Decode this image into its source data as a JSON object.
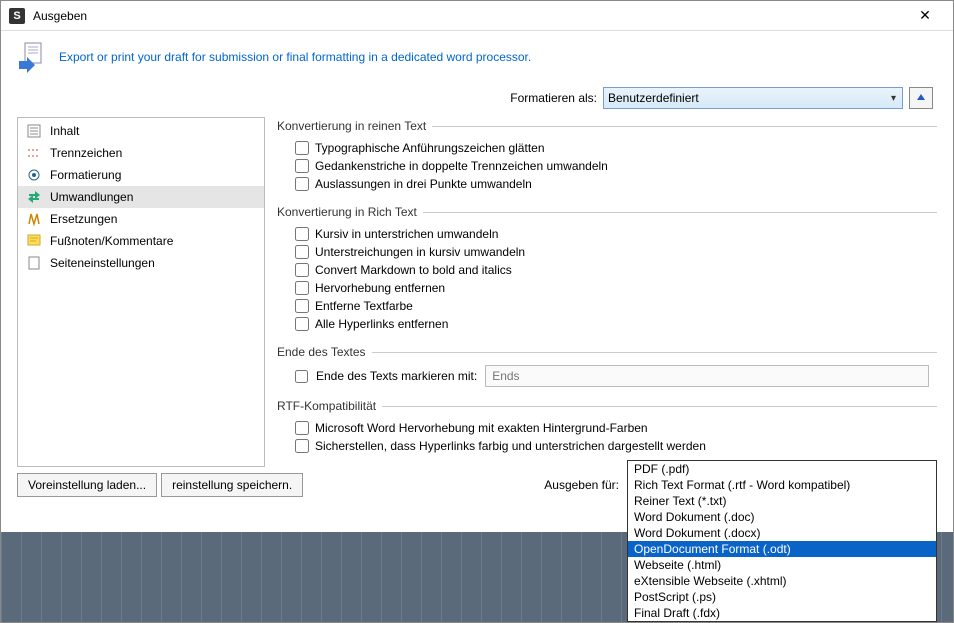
{
  "window": {
    "title": "Ausgeben"
  },
  "header": {
    "description": "Export or print your draft for submission or final formatting in a dedicated word processor."
  },
  "format": {
    "label": "Formatieren als:",
    "value": "Benutzerdefiniert"
  },
  "sidebar": {
    "items": [
      {
        "label": "Inhalt",
        "icon": "content"
      },
      {
        "label": "Trennzeichen",
        "icon": "separator"
      },
      {
        "label": "Formatierung",
        "icon": "format"
      },
      {
        "label": "Umwandlungen",
        "icon": "transform",
        "selected": true
      },
      {
        "label": "Ersetzungen",
        "icon": "replace"
      },
      {
        "label": "Fußnoten/Kommentare",
        "icon": "notes"
      },
      {
        "label": "Seiteneinstellungen",
        "icon": "page"
      }
    ]
  },
  "groups": {
    "plaintext": {
      "legend": "Konvertierung in reinen Text",
      "items": [
        "Typographische Anführungszeichen glätten",
        "Gedankenstriche in doppelte Trennzeichen umwandeln",
        "Auslassungen in drei Punkte umwandeln"
      ]
    },
    "richtext": {
      "legend": "Konvertierung in Rich Text",
      "items": [
        "Kursiv in unterstrichen umwandeln",
        "Unterstreichungen in kursiv umwandeln",
        "Convert Markdown to bold and italics",
        "Hervorhebung entfernen",
        "Entferne Textfarbe",
        "Alle Hyperlinks entfernen"
      ]
    },
    "endtext": {
      "legend": "Ende des Textes",
      "checkbox": "Ende des Texts markieren mit:",
      "placeholder": "Ends"
    },
    "rtfcompat": {
      "legend": "RTF-Kompatibilität",
      "items": [
        "Microsoft Word Hervorhebung mit exakten Hintergrund-Farben",
        "Sicherstellen, dass Hyperlinks farbig und unterstrichen dargestellt werden"
      ]
    }
  },
  "footer": {
    "load_preset": "Voreinstellung laden...",
    "save_preset": "reinstellung speichern.",
    "output_label": "Ausgeben für:",
    "output_value": "Word Dokument (.doc)",
    "options": [
      "PDF (.pdf)",
      "Rich Text Format (.rtf - Word kompatibel)",
      "Reiner Text (*.txt)",
      "Word Dokument (.doc)",
      "Word Dokument (.docx)",
      "OpenDocument Format (.odt)",
      "Webseite (.html)",
      "eXtensible Webseite (.xhtml)",
      "PostScript (.ps)",
      "Final Draft (.fdx)"
    ],
    "highlighted": 5
  }
}
